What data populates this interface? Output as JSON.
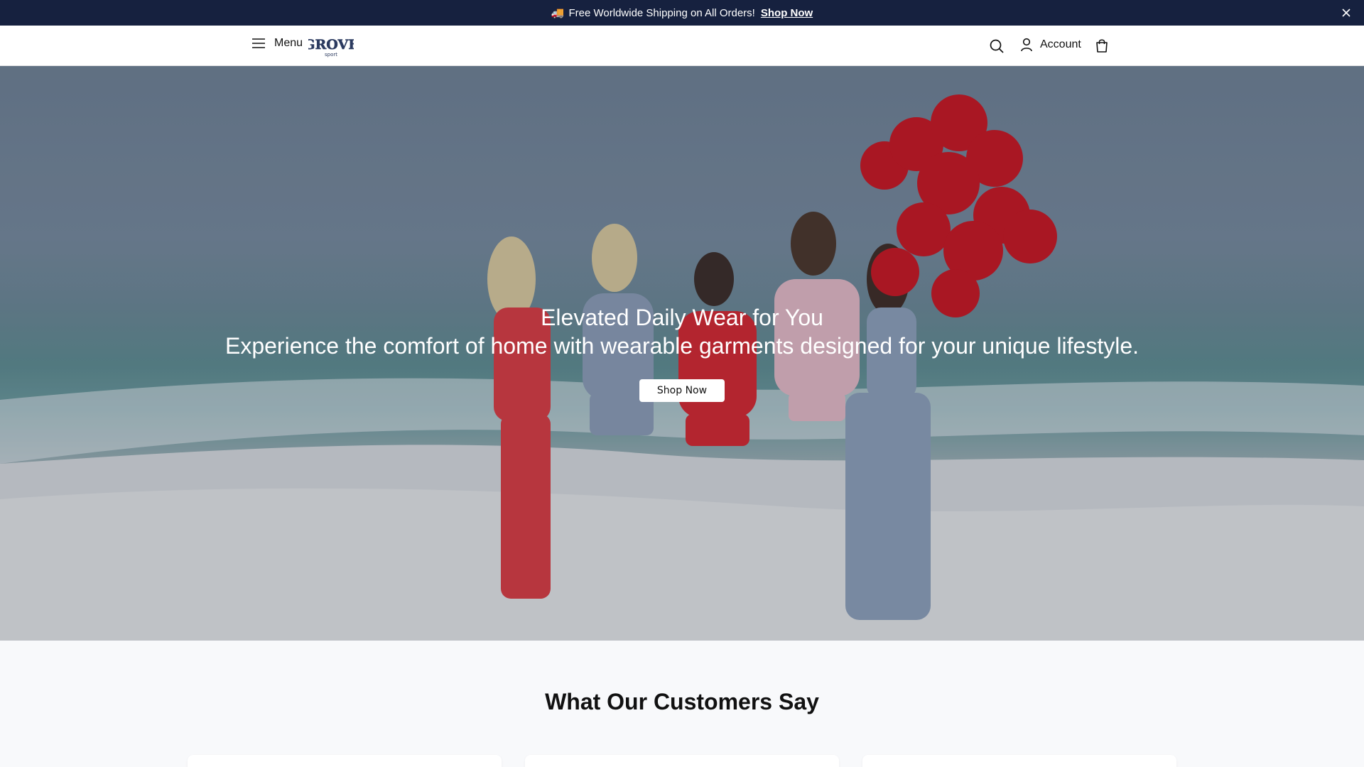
{
  "announcement": {
    "icon": "truck-icon",
    "text": "Free Worldwide Shipping on All Orders!",
    "link": "Shop Now"
  },
  "header": {
    "menu_label": "Menu",
    "logo_text": "GROVE",
    "logo_subtext": "sport",
    "account_label": "Account"
  },
  "hero": {
    "title": "Elevated Daily Wear for You",
    "subtitle": "Experience the comfort of home with wearable garments designed for your unique lifestyle.",
    "cta": "Shop Now"
  },
  "testimonials": {
    "title": "What Our Customers Say",
    "cards": [
      {},
      {},
      {}
    ]
  },
  "colors": {
    "announcement_bg": "#16213f",
    "header_bg": "#ffffff",
    "page_bg": "#f8f9fb",
    "balloon_red": "#c8141e"
  }
}
